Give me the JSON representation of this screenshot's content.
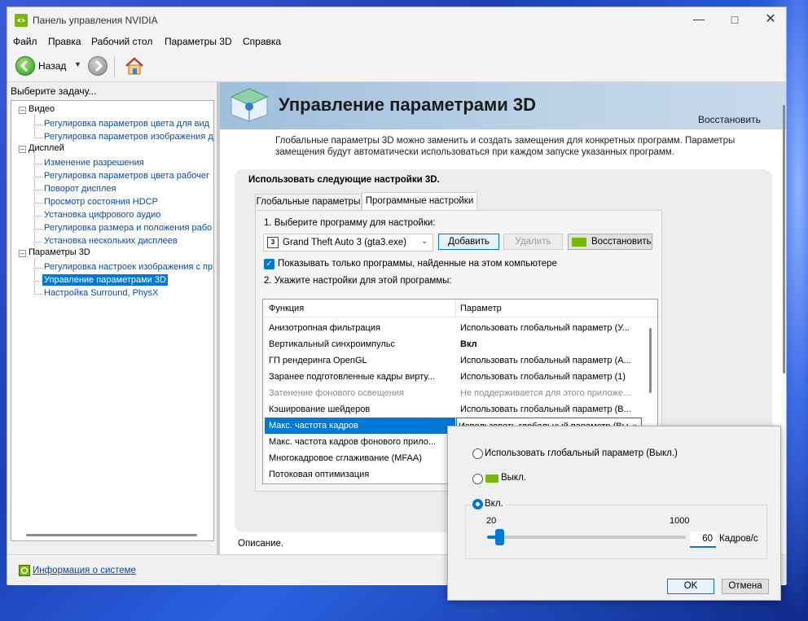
{
  "window": {
    "title": "Панель управления NVIDIA"
  },
  "menu": [
    "Файл",
    "Правка",
    "Рабочий стол",
    "Параметры 3D",
    "Справка"
  ],
  "toolbar": {
    "back_label": "Назад"
  },
  "sidebar": {
    "prompt": "Выберите задачу...",
    "categories": [
      {
        "label": "Видео",
        "items": [
          "Регулировка параметров цвета для вид",
          "Регулировка параметров изображения д"
        ]
      },
      {
        "label": "Дисплей",
        "items": [
          "Изменение разрешения",
          "Регулировка параметров цвета рабочег",
          "Поворот дисплея",
          "Просмотр состояния HDCP",
          "Установка цифрового аудио",
          "Регулировка размера и положения рабо",
          "Установка нескольких дисплеев"
        ]
      },
      {
        "label": "Параметры 3D",
        "items": [
          "Регулировка настроек изображения с пр",
          "Управление параметрами 3D",
          "Настройка Surround, PhysX"
        ]
      }
    ],
    "selected": "Управление параметрами 3D"
  },
  "header": {
    "title": "Управление параметрами 3D",
    "restore_link": "Восстановить",
    "description": "Глобальные параметры 3D можно заменить и создать замещения для конкретных программ. Параметры замещения будут автоматически использоваться при каждом запуске указанных программ."
  },
  "panel": {
    "heading": "Использовать следующие настройки 3D.",
    "tabs": [
      "Глобальные параметры",
      "Программные настройки"
    ],
    "step1": "1. Выберите программу для настройки:",
    "program": "Grand Theft Auto 3 (gta3.exe)",
    "add_button": "Добавить",
    "remove_button": "Удалить",
    "restore_button": "Восстановить",
    "checkbox_label": "Показывать только программы, найденные на этом компьютере",
    "step2": "2. Укажите настройки для этой программы:"
  },
  "grid": {
    "headers": [
      "Функция",
      "Параметр"
    ],
    "rows": [
      {
        "f": "Анизотропная фильтрация",
        "p": "Использовать глобальный параметр (У..."
      },
      {
        "f": "Вертикальный синхроимпульс",
        "p": "Вкл"
      },
      {
        "f": "ГП рендеринга OpenGL",
        "p": "Использовать глобальный параметр (А..."
      },
      {
        "f": "Заранее подготовленные кадры вирту...",
        "p": "Использовать глобальный параметр (1)"
      },
      {
        "f": "Затенение фонового освещения",
        "p": "Не поддерживается для этого приложе..."
      },
      {
        "f": "Кэширование шейдеров",
        "p": "Использовать глобальный параметр (В..."
      },
      {
        "f": "Макс. частота кадров",
        "p": "Использовать глобальный параметр (Вы"
      },
      {
        "f": "Макс. частота кадров фонового прило...",
        "p": ""
      },
      {
        "f": "Многокадровое сглаживание (MFAA)",
        "p": ""
      },
      {
        "f": "Потоковая оптимизация",
        "p": ""
      }
    ]
  },
  "description_label": "Описание.",
  "popup": {
    "option_global": "Использовать глобальный параметр (Выкл.)",
    "option_off": "Выкл.",
    "option_on": "Вкл.",
    "min": "20",
    "max": "1000",
    "value": "60",
    "unit": "Кадров/с",
    "slider_fraction": 0.041,
    "ok": "OK",
    "cancel": "Отмена"
  },
  "status": {
    "system_info": "Информация о системе"
  },
  "colors": {
    "accent": "#0078d7",
    "nvidia_green": "#76b900",
    "link": "#0a47b5"
  }
}
